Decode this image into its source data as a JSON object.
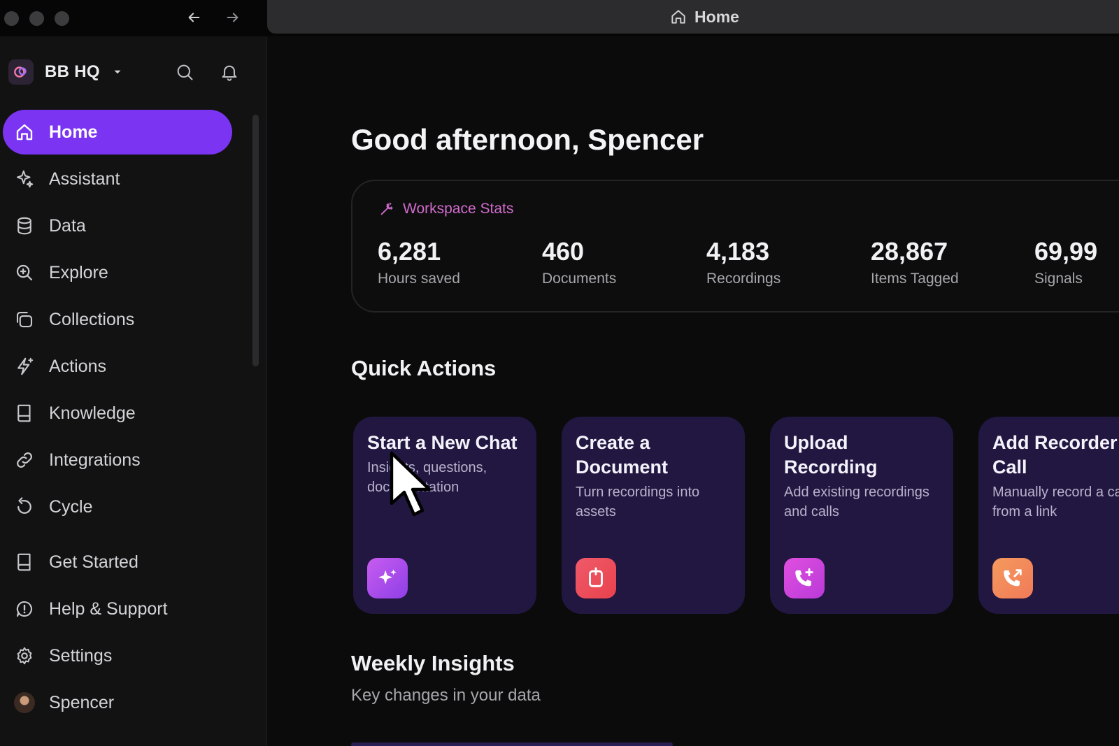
{
  "window": {
    "address_title": "Home"
  },
  "sidebar": {
    "workspace_name": "BB HQ",
    "items": [
      {
        "label": "Home",
        "icon": "home-icon",
        "active": true
      },
      {
        "label": "Assistant",
        "icon": "sparkle-icon",
        "active": false
      },
      {
        "label": "Data",
        "icon": "database-icon",
        "active": false
      },
      {
        "label": "Explore",
        "icon": "zoom-search-icon",
        "active": false
      },
      {
        "label": "Collections",
        "icon": "collections-icon",
        "active": false
      },
      {
        "label": "Actions",
        "icon": "bolt-sparkle-icon",
        "active": false
      },
      {
        "label": "Knowledge",
        "icon": "book-icon",
        "active": false
      },
      {
        "label": "Integrations",
        "icon": "link-icon",
        "active": false
      },
      {
        "label": "Cycle",
        "icon": "cycle-icon",
        "active": false
      }
    ],
    "bottom_items": [
      {
        "label": "Get Started",
        "icon": "book-icon"
      },
      {
        "label": "Help & Support",
        "icon": "help-icon"
      },
      {
        "label": "Settings",
        "icon": "gear-icon"
      },
      {
        "label": "Spencer",
        "icon": "avatar"
      }
    ]
  },
  "main": {
    "greeting": "Good afternoon, Spencer",
    "stats": {
      "title": "Workspace Stats",
      "items": [
        {
          "value": "6,281",
          "label": "Hours saved"
        },
        {
          "value": "460",
          "label": "Documents"
        },
        {
          "value": "4,183",
          "label": "Recordings"
        },
        {
          "value": "28,867",
          "label": "Items Tagged"
        },
        {
          "value": "69,99",
          "label": "Signals"
        }
      ]
    },
    "quick_actions": {
      "title": "Quick Actions",
      "cards": [
        {
          "title": "Start a New Chat",
          "desc": "Insights, questions, documentation",
          "icon": "sparkle-icon",
          "color": "#b04fe8"
        },
        {
          "title": "Create a Document",
          "desc": "Turn recordings into assets",
          "icon": "document-add-icon",
          "color": "#ef4e5e"
        },
        {
          "title": "Upload Recording",
          "desc": "Add existing recordings and calls",
          "icon": "phone-plus-icon",
          "color": "#d13bd8"
        },
        {
          "title": "Add Recorder to Call",
          "desc": "Manually record a call from a link",
          "icon": "phone-call-icon",
          "color": "#f5885a"
        }
      ]
    },
    "weekly_insights": {
      "title": "Weekly Insights",
      "subtitle": "Key changes in your data"
    }
  },
  "colors": {
    "accent": "#7b35f2",
    "stats_title": "#d16ccb",
    "card_bg": "#221741"
  }
}
